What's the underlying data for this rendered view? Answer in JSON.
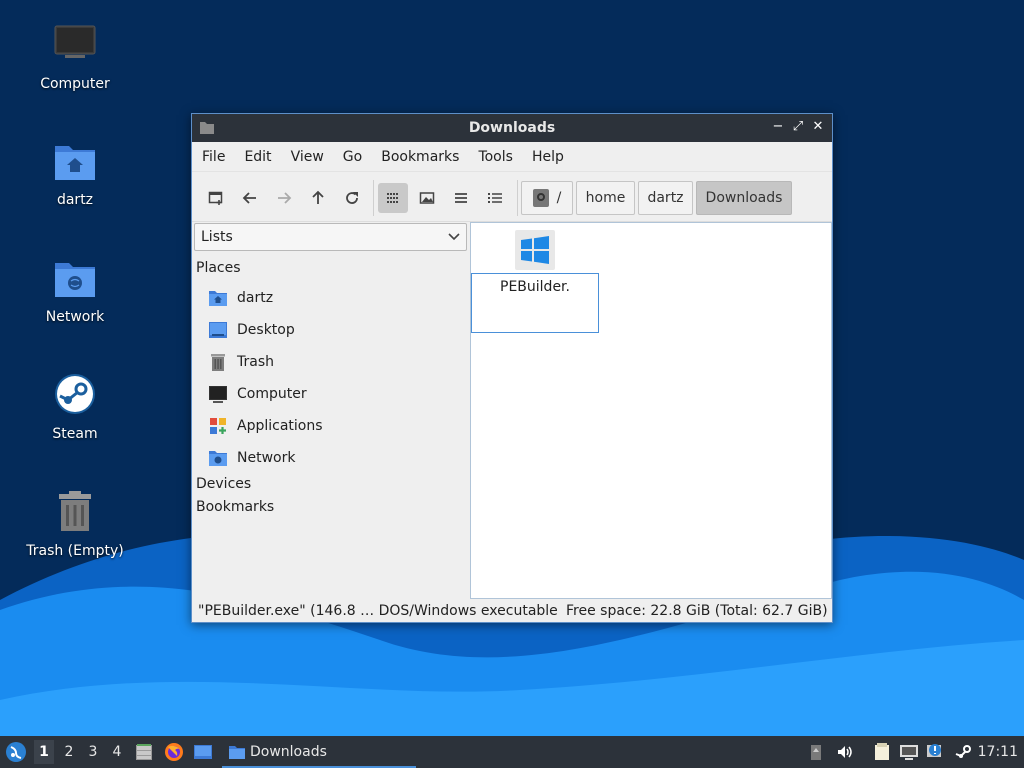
{
  "desktop": {
    "icons": [
      {
        "label": "Computer"
      },
      {
        "label": "dartz"
      },
      {
        "label": "Network"
      },
      {
        "label": "Steam"
      },
      {
        "label": "Trash (Empty)"
      }
    ]
  },
  "window": {
    "title": "Downloads",
    "controls": {
      "minimize": "−",
      "maximize": "⤢",
      "close": "✕"
    },
    "menu": [
      "File",
      "Edit",
      "View",
      "Go",
      "Bookmarks",
      "Tools",
      "Help"
    ],
    "breadcrumb": {
      "root": "/",
      "items": [
        "home",
        "dartz",
        "Downloads"
      ]
    },
    "side_pane": {
      "mode": "Lists",
      "places_heading": "Places",
      "places": [
        "dartz",
        "Desktop",
        "Trash",
        "Computer",
        "Applications",
        "Network"
      ],
      "devices_heading": "Devices",
      "bookmarks_heading": "Bookmarks"
    },
    "files": [
      {
        "name": "PEBuilder.",
        "icon": "windows-executable-icon"
      }
    ],
    "status": {
      "selection": "\"PEBuilder.exe\" (146.8 … DOS/Windows executable",
      "free_space": "Free space: 22.8 GiB (Total: 62.7 GiB)"
    }
  },
  "taskbar": {
    "workspaces": [
      "1",
      "2",
      "3",
      "4"
    ],
    "active_workspace": "1",
    "task": "Downloads",
    "clock": "17:11"
  },
  "colors": {
    "accent": "#4a90d9",
    "titlebar": "#2c323a",
    "desktop_dark": "#042b5a",
    "desktop_wave": "#1a8cf0"
  }
}
